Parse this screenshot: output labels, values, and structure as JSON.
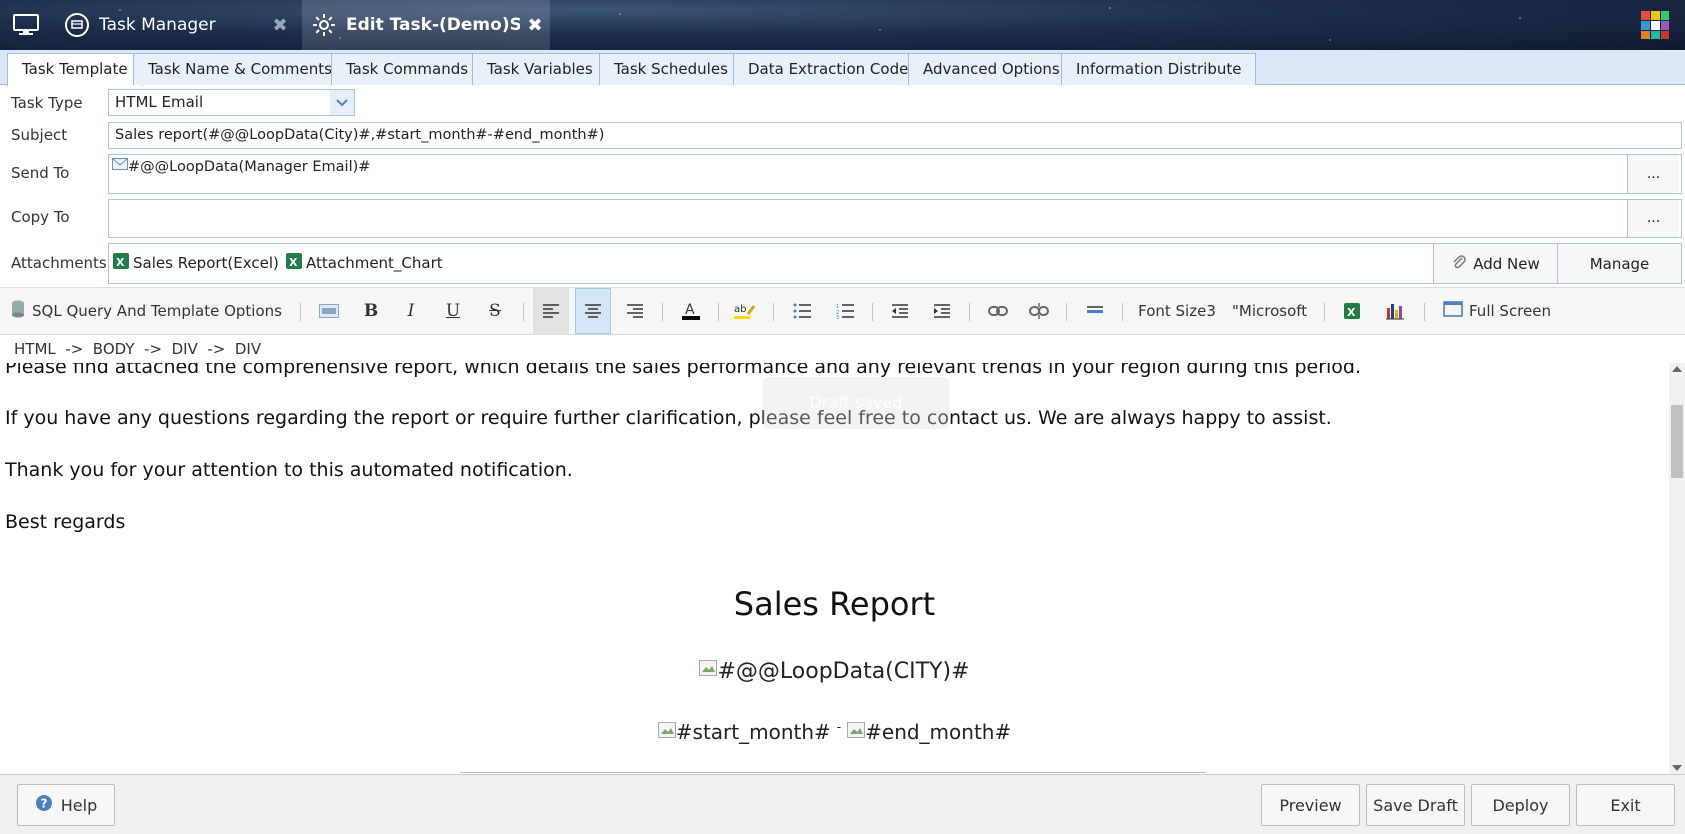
{
  "titlebar": {
    "tab1_label": "Task Manager",
    "tab2_label": "Edit Task-(Demo)Sal...",
    "close_glyph": "✖"
  },
  "tabs": [
    "Task Template",
    "Task Name & Comments",
    "Task Commands",
    "Task Variables",
    "Task Schedules",
    "Data Extraction Code",
    "Advanced Options",
    "Information Distribute"
  ],
  "form": {
    "task_type_label": "Task Type",
    "task_type_value": "HTML Email",
    "subject_label": "Subject",
    "subject_value": "Sales report(#@@LoopData(City)#,#start_month#-#end_month#)",
    "send_to_label": "Send To",
    "send_to_value": "#@@LoopData(Manager Email)#",
    "copy_to_label": "Copy To",
    "copy_to_value": "",
    "dots": "...",
    "attachments_label": "Attachments",
    "attachment_items": [
      "Sales Report(Excel)",
      "Attachment_Chart"
    ],
    "add_new_label": "Add New",
    "manage_label": "Manage"
  },
  "toolbar": {
    "sql_options": "SQL Query And Template Options",
    "font_size": "Font Size3",
    "font_name": "\"Microsoft",
    "full_screen": "Full Screen"
  },
  "path": {
    "text": "HTML  ->  BODY  ->  DIV  ->  DIV"
  },
  "editor": {
    "line1": "Please find attached the comprehensive report, which details the sales performance and any relevant trends in your region during this period.",
    "line2": "If you have any questions regarding the report or require further clarification, please feel free to contact us. We are always happy to assist.",
    "line3": "Thank you for your attention to this automated notification.",
    "line4": "Best regards",
    "report_title": "Sales Report",
    "city_placeholder": "#@@LoopData(CITY)#",
    "start_month": "#start_month#",
    "dash": "-",
    "end_month": "#end_month#",
    "toast": "Draft saved"
  },
  "footer": {
    "help": "Help",
    "preview": "Preview",
    "save_draft": "Save Draft",
    "deploy": "Deploy",
    "exit": "Exit"
  },
  "colors": {
    "titlebar": "#1c2d4a",
    "tabstrip": "#dbe8f7",
    "field_border": "#a8c4e0"
  }
}
